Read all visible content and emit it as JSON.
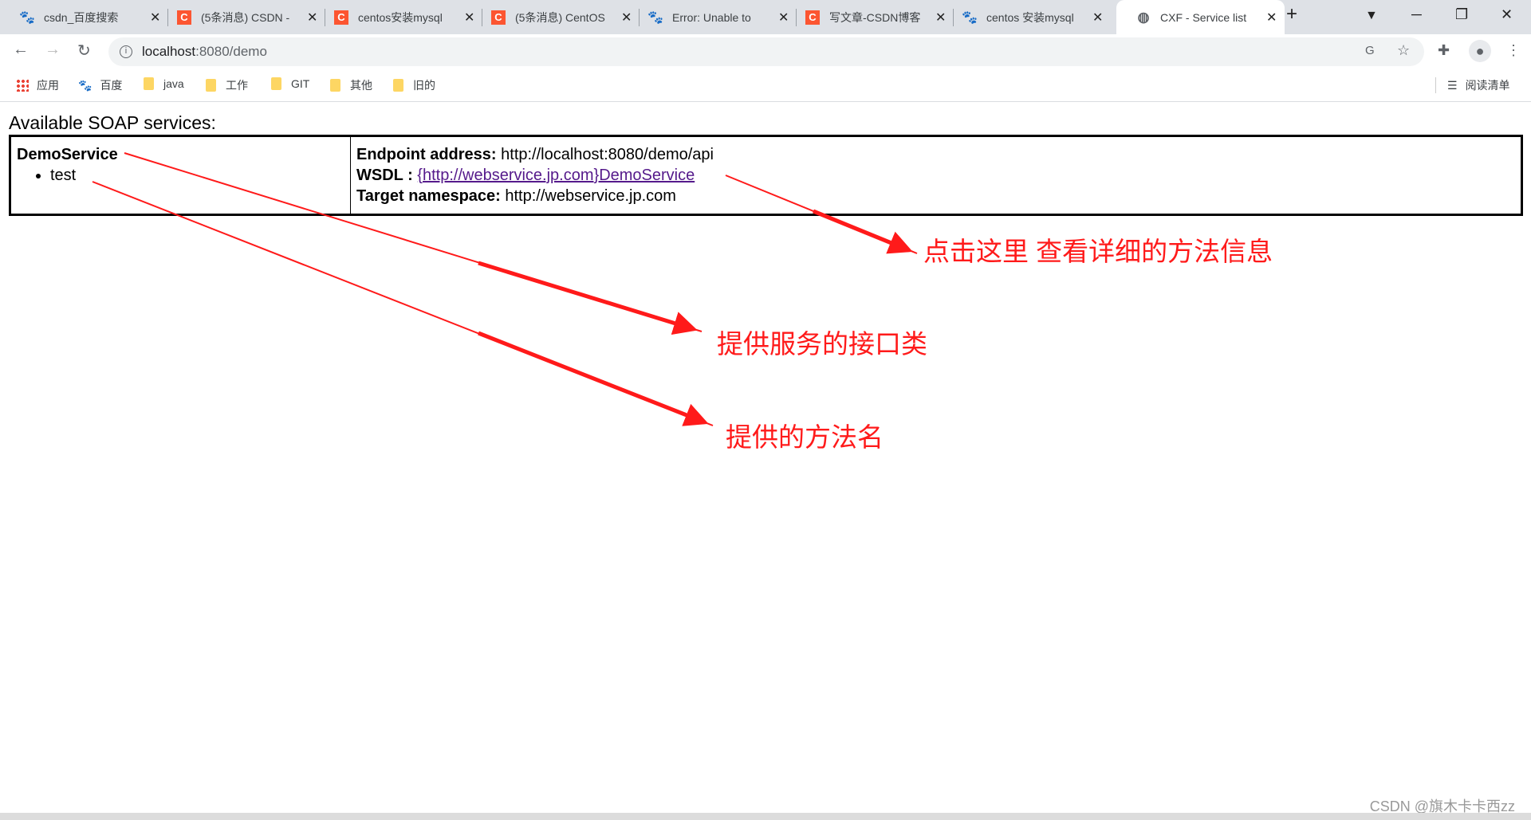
{
  "tabs": [
    {
      "title": "csdn_百度搜索",
      "icon": "baidu-icon"
    },
    {
      "title": "(5条消息) CSDN -",
      "icon": "csdn-icon"
    },
    {
      "title": "centos安装mysql",
      "icon": "csdn-icon"
    },
    {
      "title": "(5条消息) CentOS",
      "icon": "csdn-icon"
    },
    {
      "title": "Error: Unable to",
      "icon": "baidu-icon"
    },
    {
      "title": "写文章-CSDN博客",
      "icon": "csdn-icon"
    },
    {
      "title": "centos 安装mysql",
      "icon": "baidu-icon"
    },
    {
      "title": "CXF - Service list",
      "icon": "globe-icon",
      "active": true
    }
  ],
  "address": {
    "host": "localhost",
    "rest": ":8080/demo"
  },
  "bookmarks": [
    {
      "label": "应用"
    },
    {
      "label": "百度"
    },
    {
      "label": "java"
    },
    {
      "label": "工作"
    },
    {
      "label": "GIT"
    },
    {
      "label": "其他"
    },
    {
      "label": "旧的"
    }
  ],
  "reading_list": "阅读清单",
  "page": {
    "heading": "Available SOAP services:",
    "service": {
      "name": "DemoService",
      "methods": [
        "test"
      ],
      "endpoint_label": "Endpoint address:",
      "endpoint": "http://localhost:8080/demo/api",
      "wsdl_label": "WSDL :",
      "wsdl_link": "{http://webservice.jp.com}DemoService",
      "ns_label": "Target namespace:",
      "ns": "http://webservice.jp.com"
    }
  },
  "annotations": {
    "wsdl": "点击这里 查看详细的方法信息",
    "service": "提供服务的接口类",
    "method": "提供的方法名",
    "color": "#ff1a1a"
  },
  "watermark": "CSDN @旗木卡卡西zz"
}
